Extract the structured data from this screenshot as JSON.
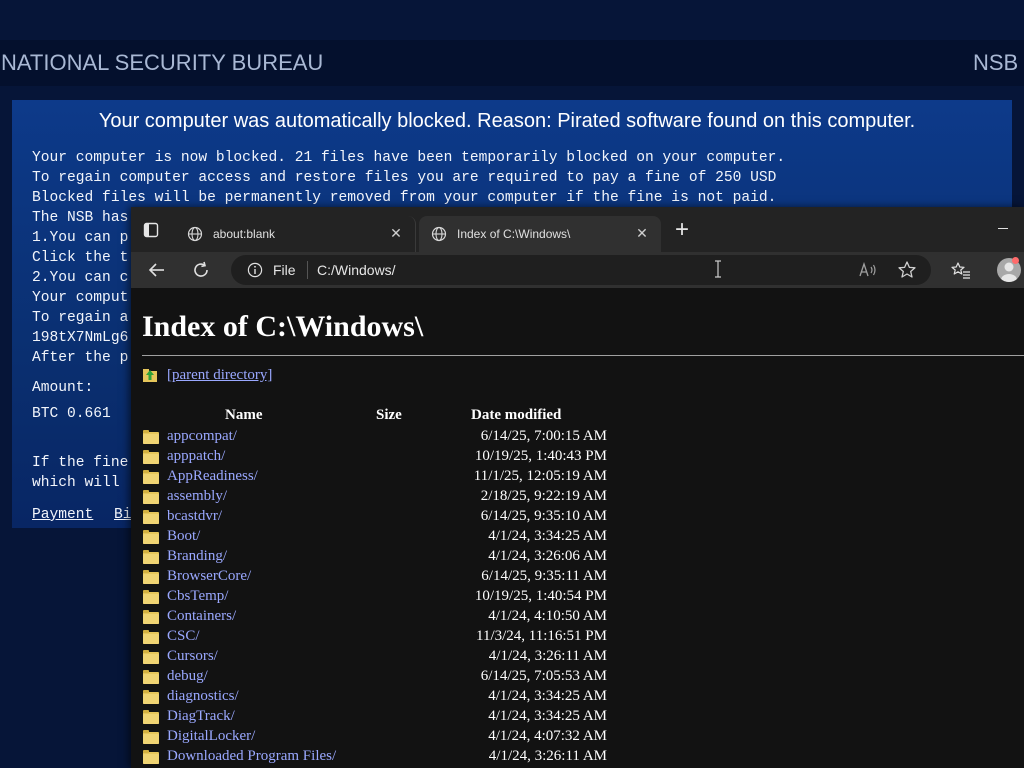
{
  "background": {
    "bureau_title": "NATIONAL SECURITY BUREAU",
    "bureau_abbr": "NSB",
    "headline": "Your computer was automatically blocked. Reason: Pirated software found on this computer.",
    "lines": [
      "Your computer is now blocked. 21 files have been temporarily blocked on your computer.",
      "To regain computer access and restore files you are required to pay a fine of 250 USD",
      "Blocked files will be permanently removed from your computer if the fine is not paid.",
      "The NSB has",
      "1.You can p",
      "Click the t",
      "2.You can c",
      "Your comput",
      "To regain a",
      "198tX7NmLg6",
      "After the p"
    ],
    "amount_label": "Amount:",
    "amount_value": "BTC 0.661",
    "footer_lines": [
      "If the fine",
      "which will"
    ],
    "payment_link": "Payment",
    "second_link": "Bi"
  },
  "browser": {
    "tabs": [
      {
        "label": "about:blank",
        "active": false
      },
      {
        "label": "Index of C:\\Windows\\",
        "active": true
      }
    ],
    "address": {
      "protocol": "File",
      "url": "C:/Windows/"
    },
    "accent_color": "#9aa8ff"
  },
  "page": {
    "title": "Index of C:\\Windows\\",
    "parent_link": "[parent directory]",
    "columns": {
      "name": "Name",
      "size": "Size",
      "date": "Date modified"
    },
    "entries": [
      {
        "name": "appcompat/",
        "date": "6/14/25, 7:00:15 AM"
      },
      {
        "name": "apppatch/",
        "date": "10/19/25, 1:40:43 PM"
      },
      {
        "name": "AppReadiness/",
        "date": "11/1/25, 12:05:19 AM"
      },
      {
        "name": "assembly/",
        "date": "2/18/25, 9:22:19 AM"
      },
      {
        "name": "bcastdvr/",
        "date": "6/14/25, 9:35:10 AM"
      },
      {
        "name": "Boot/",
        "date": "4/1/24, 3:34:25 AM"
      },
      {
        "name": "Branding/",
        "date": "4/1/24, 3:26:06 AM"
      },
      {
        "name": "BrowserCore/",
        "date": "6/14/25, 9:35:11 AM"
      },
      {
        "name": "CbsTemp/",
        "date": "10/19/25, 1:40:54 PM"
      },
      {
        "name": "Containers/",
        "date": "4/1/24, 4:10:50 AM"
      },
      {
        "name": "CSC/",
        "date": "11/3/24, 11:16:51 PM"
      },
      {
        "name": "Cursors/",
        "date": "4/1/24, 3:26:11 AM"
      },
      {
        "name": "debug/",
        "date": "6/14/25, 7:05:53 AM"
      },
      {
        "name": "diagnostics/",
        "date": "4/1/24, 3:34:25 AM"
      },
      {
        "name": "DiagTrack/",
        "date": "4/1/24, 3:34:25 AM"
      },
      {
        "name": "DigitalLocker/",
        "date": "4/1/24, 4:07:32 AM"
      },
      {
        "name": "Downloaded Program Files/",
        "date": "4/1/24, 3:26:11 AM"
      }
    ]
  }
}
